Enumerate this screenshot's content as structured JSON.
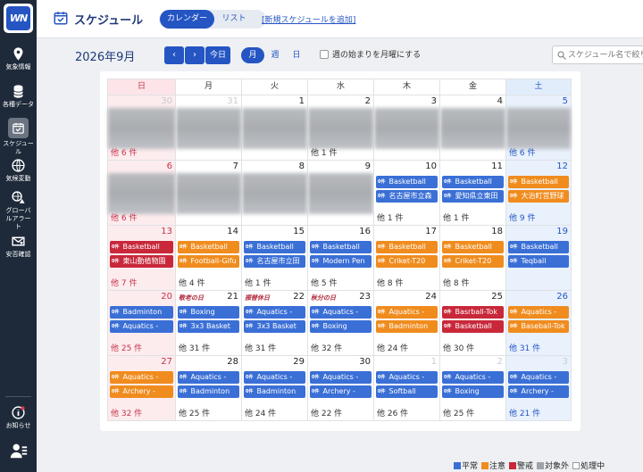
{
  "app": {
    "logo_text": "WN"
  },
  "sidebar": {
    "items": [
      {
        "label": "気象情報",
        "icon": "map-pin-icon"
      },
      {
        "label": "各種データ",
        "icon": "database-icon"
      },
      {
        "label": "スケジュール",
        "icon": "calendar-icon",
        "active": true
      },
      {
        "label": "気候変動",
        "icon": "globe-icon"
      },
      {
        "label": "グローバルアラート",
        "icon": "globe-alert-icon"
      },
      {
        "label": "安否確認",
        "icon": "mail-heart-icon"
      },
      {
        "label": "お知らせ",
        "icon": "info-icon"
      }
    ]
  },
  "header": {
    "title": "スケジュール",
    "tabs": [
      {
        "label": "カレンダー",
        "active": true
      },
      {
        "label": "リスト"
      }
    ],
    "add_link": "[新規スケジュールを追加]"
  },
  "toolbar": {
    "month": "2026年9月",
    "prev": "‹",
    "next": "›",
    "today": "今日",
    "modes": [
      "月",
      "週",
      "日"
    ],
    "monday_start_label": "週の始まりを月曜にする",
    "search_placeholder": "スケジュール名で絞り込み"
  },
  "calendar": {
    "weekdays": [
      "日",
      "月",
      "火",
      "水",
      "木",
      "金",
      "土"
    ],
    "event_tag": "0件",
    "weeks": [
      {
        "days": [
          {
            "num": "30",
            "dim": true,
            "blur": true,
            "more": "他 6 件"
          },
          {
            "num": "31",
            "dim": true,
            "blur": true,
            "more": ""
          },
          {
            "num": "1",
            "blur": true,
            "more": ""
          },
          {
            "num": "2",
            "blur": true,
            "more": "他 1 件"
          },
          {
            "num": "3",
            "blur": true,
            "more": ""
          },
          {
            "num": "4",
            "blur": true,
            "more": ""
          },
          {
            "num": "5",
            "blur": true,
            "more": "他 6 件"
          }
        ]
      },
      {
        "days": [
          {
            "num": "6",
            "blur": true,
            "more": "他 6 件"
          },
          {
            "num": "7",
            "blur": true,
            "more": ""
          },
          {
            "num": "8",
            "blur": true,
            "more": ""
          },
          {
            "num": "9",
            "blur": true,
            "more": ""
          },
          {
            "num": "10",
            "events": [
              {
                "label": "Basketball",
                "color": "blue"
              },
              {
                "label": "名古屋市立森",
                "color": "blue"
              }
            ],
            "more": "他 1 件"
          },
          {
            "num": "11",
            "events": [
              {
                "label": "Basketball",
                "color": "blue"
              },
              {
                "label": "愛知県立東田",
                "color": "blue"
              }
            ],
            "more": "他 1 件"
          },
          {
            "num": "12",
            "events": [
              {
                "label": "Basketball",
                "color": "orange"
              },
              {
                "label": "大治町営野球",
                "color": "orange"
              }
            ],
            "more": "他 9 件"
          }
        ]
      },
      {
        "days": [
          {
            "num": "13",
            "events": [
              {
                "label": "Basketball",
                "color": "red"
              },
              {
                "label": "東山動植物園",
                "color": "red"
              }
            ],
            "more": "他 7 件"
          },
          {
            "num": "14",
            "events": [
              {
                "label": "Basketball",
                "color": "orange"
              },
              {
                "label": "Football-Gifu",
                "color": "orange"
              }
            ],
            "more": "他 4 件"
          },
          {
            "num": "15",
            "events": [
              {
                "label": "Basketball",
                "color": "blue"
              },
              {
                "label": "名古屋市立田",
                "color": "blue"
              }
            ],
            "more": "他 1 件"
          },
          {
            "num": "16",
            "events": [
              {
                "label": "Basketball",
                "color": "blue"
              },
              {
                "label": "Modern Pen",
                "color": "blue"
              }
            ],
            "more": "他 5 件"
          },
          {
            "num": "17",
            "events": [
              {
                "label": "Basketball",
                "color": "orange"
              },
              {
                "label": "Criket-T20",
                "color": "orange"
              }
            ],
            "more": "他 8 件"
          },
          {
            "num": "18",
            "events": [
              {
                "label": "Basketball",
                "color": "orange"
              },
              {
                "label": "Criket-T20",
                "color": "orange"
              }
            ],
            "more": "他 8 件"
          },
          {
            "num": "19",
            "events": [
              {
                "label": "Basketball",
                "color": "blue"
              },
              {
                "label": "Teqball",
                "color": "blue"
              }
            ],
            "more": ""
          }
        ]
      },
      {
        "days": [
          {
            "num": "20",
            "events": [
              {
                "label": "Badminton",
                "color": "blue"
              },
              {
                "label": "Aquatics -",
                "color": "blue"
              }
            ],
            "more": "他 25 件"
          },
          {
            "num": "21",
            "holiday": "敬老の日",
            "events": [
              {
                "label": "Boxing",
                "color": "blue"
              },
              {
                "label": "3x3 Basket",
                "color": "blue"
              }
            ],
            "more": "他 31 件"
          },
          {
            "num": "22",
            "holiday": "振替休日",
            "events": [
              {
                "label": "Aquatics -",
                "color": "blue"
              },
              {
                "label": "3x3 Basket",
                "color": "blue"
              }
            ],
            "more": "他 31 件"
          },
          {
            "num": "23",
            "holiday": "秋分の日",
            "events": [
              {
                "label": "Aquatics -",
                "color": "blue"
              },
              {
                "label": "Boxing",
                "color": "blue"
              }
            ],
            "more": "他 32 件"
          },
          {
            "num": "24",
            "events": [
              {
                "label": "Aquatics -",
                "color": "orange"
              },
              {
                "label": "Badminton",
                "color": "orange"
              }
            ],
            "more": "他 24 件"
          },
          {
            "num": "25",
            "events": [
              {
                "label": "Basrball-Tok",
                "color": "red"
              },
              {
                "label": "Basketball",
                "color": "red"
              }
            ],
            "more": "他 30 件"
          },
          {
            "num": "26",
            "events": [
              {
                "label": "Aquatics -",
                "color": "orange"
              },
              {
                "label": "Baseball-Tok",
                "color": "orange"
              }
            ],
            "more": "他 31 件"
          }
        ]
      },
      {
        "days": [
          {
            "num": "27",
            "events": [
              {
                "label": "Aquatics -",
                "color": "orange"
              },
              {
                "label": "Archery -",
                "color": "orange"
              }
            ],
            "more": "他 32 件"
          },
          {
            "num": "28",
            "events": [
              {
                "label": "Aquatics -",
                "color": "blue"
              },
              {
                "label": "Badminton",
                "color": "blue"
              }
            ],
            "more": "他 25 件"
          },
          {
            "num": "29",
            "events": [
              {
                "label": "Aquatics -",
                "color": "blue"
              },
              {
                "label": "Badminton",
                "color": "blue"
              }
            ],
            "more": "他 24 件"
          },
          {
            "num": "30",
            "events": [
              {
                "label": "Aquatics -",
                "color": "blue"
              },
              {
                "label": "Archery -",
                "color": "blue"
              }
            ],
            "more": "他 22 件"
          },
          {
            "num": "1",
            "dim": true,
            "events": [
              {
                "label": "Aquatics -",
                "color": "blue"
              },
              {
                "label": "Softball",
                "color": "blue"
              }
            ],
            "more": "他 26 件"
          },
          {
            "num": "2",
            "dim": true,
            "events": [
              {
                "label": "Aquatics -",
                "color": "blue"
              },
              {
                "label": "Boxing",
                "color": "blue"
              }
            ],
            "more": "他 25 件"
          },
          {
            "num": "3",
            "dim": true,
            "events": [
              {
                "label": "Aquatics -",
                "color": "blue"
              },
              {
                "label": "Archery -",
                "color": "blue"
              }
            ],
            "more": "他 21 件"
          }
        ]
      }
    ]
  },
  "legend": [
    {
      "label": "平常",
      "color": "#3a6fd6"
    },
    {
      "label": "注意",
      "color": "#f08c1e"
    },
    {
      "label": "警戒",
      "color": "#c8283a"
    },
    {
      "label": "対象外",
      "color": "#9ea3a8"
    },
    {
      "label": "処理中",
      "color": "#ffffff"
    }
  ],
  "colors": {
    "blue": "#3a6fd6",
    "orange": "#f08c1e",
    "red": "#c8283a",
    "accent": "#2455c3"
  }
}
